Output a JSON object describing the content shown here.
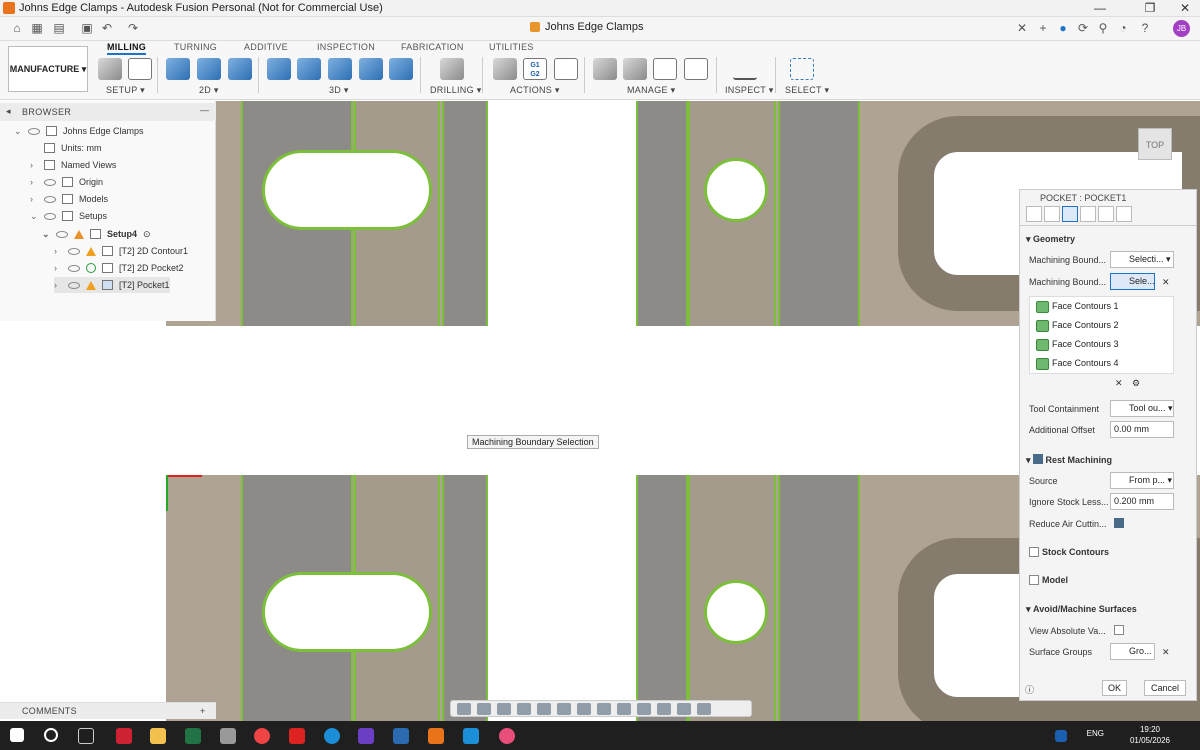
{
  "window": {
    "title": "Johns Edge Clamps - Autodesk Fusion Personal (Not for Commercial Use)",
    "doc_tab": "Johns Edge Clamps",
    "user_initials": "JB"
  },
  "ribbon": {
    "workspace": "MANUFACTURE",
    "tabs": [
      "MILLING",
      "TURNING",
      "ADDITIVE",
      "INSPECTION",
      "FABRICATION",
      "UTILITIES"
    ],
    "groups": [
      "SETUP ▾",
      "2D ▾",
      "3D ▾",
      "DRILLING ▾",
      "ACTIONS ▾",
      "MANAGE ▾",
      "INSPECT ▾",
      "SELECT ▾"
    ],
    "g_code_icon": "G1\nG2"
  },
  "browser": {
    "title": "BROWSER",
    "items": [
      {
        "label": "Johns Edge Clamps"
      },
      {
        "label": "Units: mm"
      },
      {
        "label": "Named Views"
      },
      {
        "label": "Origin"
      },
      {
        "label": "Models"
      },
      {
        "label": "Setups"
      },
      {
        "label": "Setup4"
      },
      {
        "label": "[T2] 2D Contour1"
      },
      {
        "label": "[T2] 2D Pocket2"
      },
      {
        "label": "[T2] Pocket1"
      }
    ]
  },
  "comments": "COMMENTS",
  "canvas": {
    "tooltip": "Machining Boundary Selection",
    "viewcube": "TOP"
  },
  "pocket": {
    "title": "POCKET : POCKET1",
    "geometry": "Geometry",
    "mb1_label": "Machining Bound...",
    "mb1_value": "Selecti...",
    "mb2_label": "Machining Bound...",
    "mb2_value": "Sele...",
    "contours": [
      "Face Contours 1",
      "Face Contours 2",
      "Face Contours 3",
      "Face Contours 4"
    ],
    "tool_containment_label": "Tool Containment",
    "tool_containment_value": "Tool ou...",
    "additional_offset_label": "Additional Offset",
    "additional_offset_value": "0.00 mm",
    "rest_machining": "Rest Machining",
    "source_label": "Source",
    "source_value": "From p...",
    "ignore_label": "Ignore Stock Less...",
    "ignore_value": "0.200 mm",
    "reduce_label": "Reduce Air Cuttin...",
    "stock_contours": "Stock Contours",
    "model": "Model",
    "avoid": "Avoid/Machine Surfaces",
    "view_abs_label": "View Absolute Va...",
    "surface_groups_label": "Surface Groups",
    "surface_groups_value": "Gro...",
    "ok": "OK",
    "cancel": "Cancel"
  },
  "taskbar": {
    "lang": "ENG",
    "time": "19:20",
    "date": "01/05/2026"
  }
}
